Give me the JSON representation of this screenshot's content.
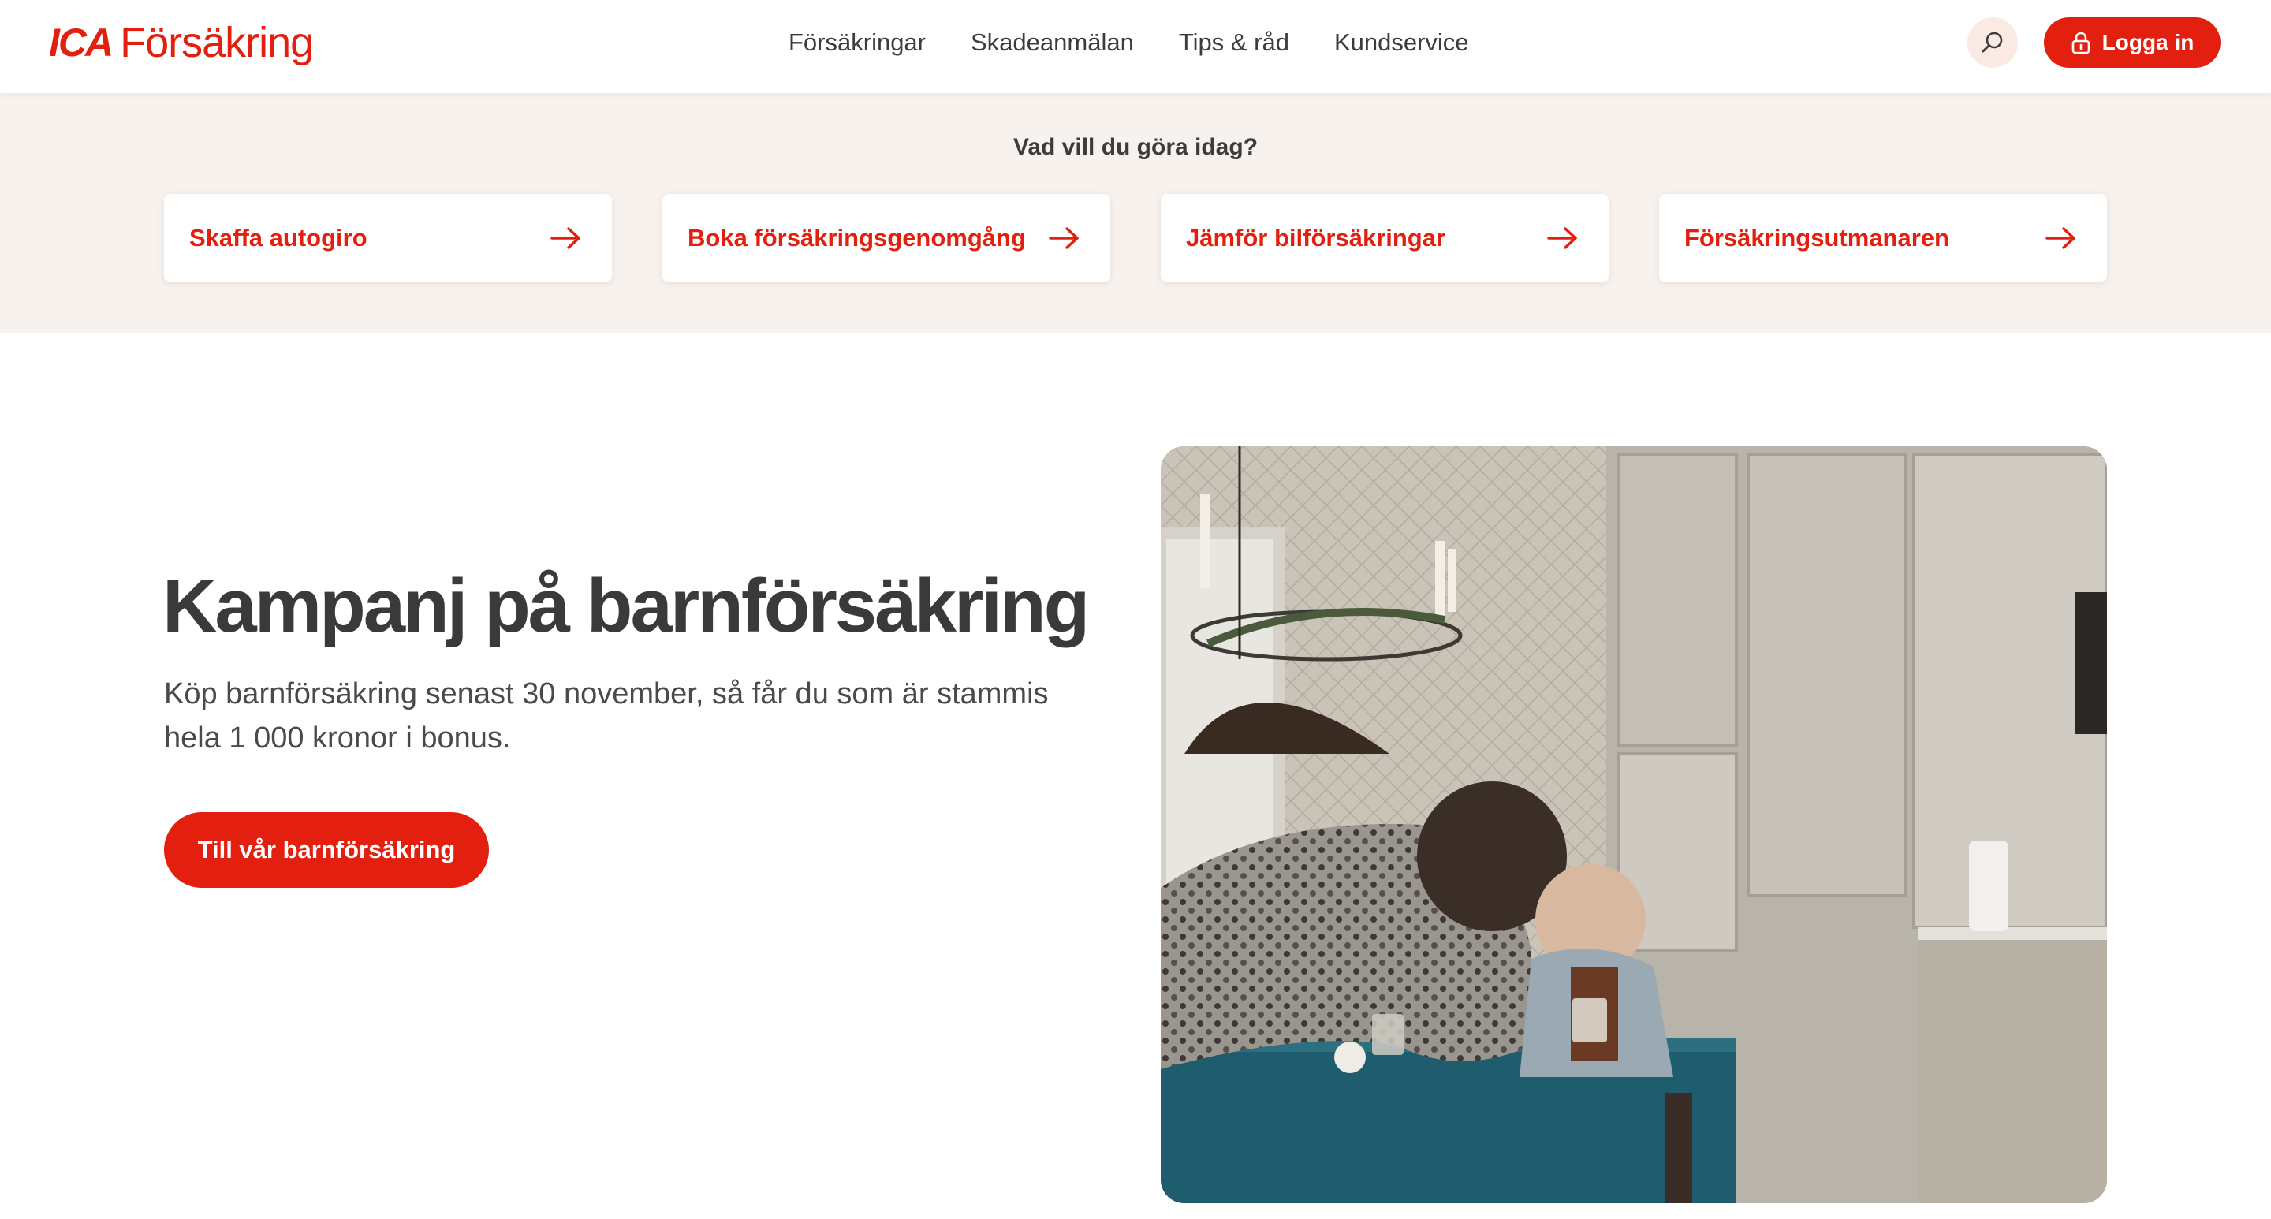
{
  "header": {
    "logo_brand": "ICA",
    "logo_text": "Försäkring",
    "nav": [
      "Försäkringar",
      "Skadeanmälan",
      "Tips & råd",
      "Kundservice"
    ],
    "login_label": "Logga in",
    "search_icon": "search-icon",
    "lock_icon": "lock-icon"
  },
  "quick_actions": {
    "title": "Vad vill du göra idag?",
    "items": [
      {
        "label": "Skaffa autogiro"
      },
      {
        "label": "Boka försäkringsgenomgång"
      },
      {
        "label": "Jämför bilförsäkringar"
      },
      {
        "label": "Försäkringsutmanaren"
      }
    ]
  },
  "hero": {
    "title": "Kampanj på barnförsäkring",
    "text": "Köp barnförsäkring senast 30 november, så får du som är stammis hela 1 000 kronor i bonus.",
    "button_label": "Till vår barnförsäkring"
  },
  "colors": {
    "brand": "#e3200f",
    "quick_bg": "#f8f2ee",
    "text": "#3c3c3c"
  }
}
